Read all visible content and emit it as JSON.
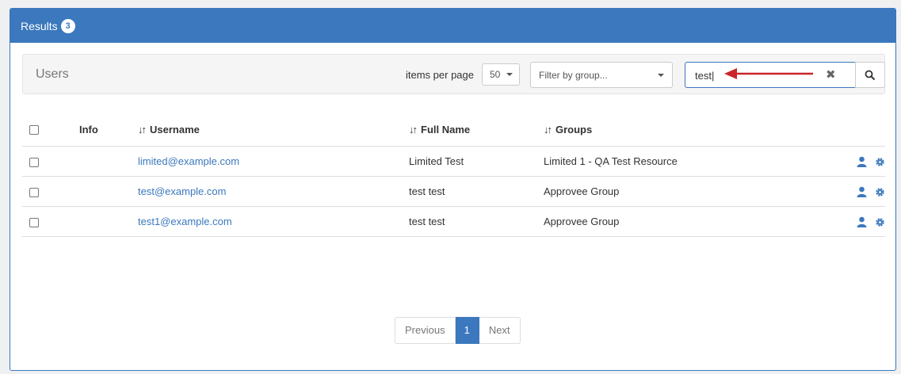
{
  "results_panel": {
    "title": "Results",
    "count": "3"
  },
  "toolbar": {
    "title": "Users",
    "items_per_page_label": "items per page",
    "items_per_page_value": "50",
    "group_filter_placeholder": "Filter by group...",
    "search_value": "test"
  },
  "table": {
    "headers": {
      "info": "Info",
      "username": "Username",
      "full_name": "Full Name",
      "groups": "Groups"
    },
    "rows": [
      {
        "username": "limited@example.com",
        "full_name": "Limited Test",
        "groups": "Limited 1 - QA Test Resource"
      },
      {
        "username": "test@example.com",
        "full_name": "test test",
        "groups": "Approvee Group"
      },
      {
        "username": "test1@example.com",
        "full_name": "test test",
        "groups": "Approvee Group"
      }
    ]
  },
  "pagination": {
    "previous": "Previous",
    "current_page": "1",
    "next": "Next"
  },
  "colors": {
    "primary": "#3b78bd",
    "annotation_arrow": "#c9252b"
  },
  "icons": {
    "sort": "sort-icon",
    "clear": "times-icon",
    "search": "magnifier-icon",
    "user": "user-icon",
    "settings": "gear-icon"
  }
}
